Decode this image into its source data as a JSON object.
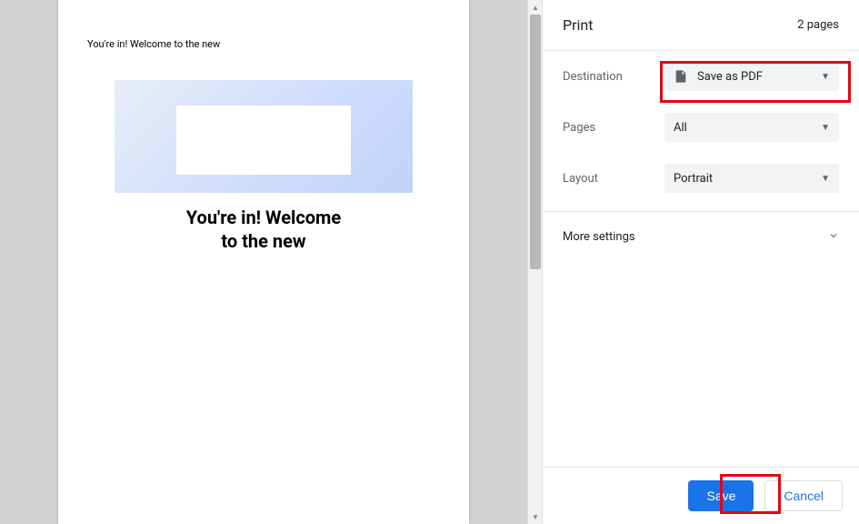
{
  "preview": {
    "header_text": "You're in! Welcome to the new",
    "heading_line1": "You're in! Welcome",
    "heading_line2": "to the new"
  },
  "panel": {
    "title": "Print",
    "page_count": "2 pages",
    "destination": {
      "label": "Destination",
      "value": "Save as PDF"
    },
    "pages": {
      "label": "Pages",
      "value": "All"
    },
    "layout": {
      "label": "Layout",
      "value": "Portrait"
    },
    "more_settings": "More settings"
  },
  "footer": {
    "save": "Save",
    "cancel": "Cancel"
  }
}
